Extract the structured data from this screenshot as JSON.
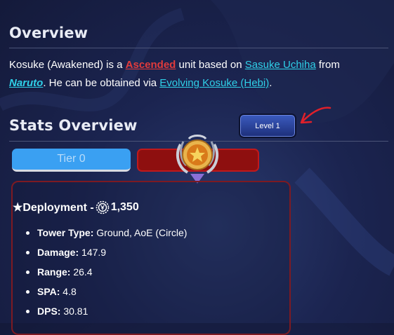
{
  "overview": {
    "heading": "Overview",
    "line1_prefix": "Kosuke (Awakened) is a ",
    "rarity_link": "Ascended",
    "line1_mid": " unit based on ",
    "character_link": "Sasuke Uchiha",
    "line1_suffix": " from",
    "series_link": "Naruto",
    "line2_mid": ". He can be obtained via ",
    "evolve_link": "Evolving Kosuke (Hebi)",
    "line2_suffix": "."
  },
  "stats_overview": {
    "heading": "Stats Overview",
    "level_button": "Level 1",
    "tabs": [
      {
        "label": "Tier 0",
        "active": true
      },
      {
        "label": "",
        "active": false
      }
    ],
    "deployment_label": "★Deployment -",
    "deployment_cost": "1,350",
    "stats": [
      {
        "label": "Tower Type:",
        "value": " Ground, AoE (Circle)"
      },
      {
        "label": "Damage:",
        "value": " 147.9"
      },
      {
        "label": "Range:",
        "value": " 26.4"
      },
      {
        "label": "SPA:",
        "value": " 4.8"
      },
      {
        "label": "DPS:",
        "value": " 30.81"
      }
    ]
  },
  "colors": {
    "ascended": "#e23b3b",
    "link": "#2fd0e8",
    "tab_active": "#3aa0f2",
    "tab_inactive": "#8e0f0f",
    "annotation_arrow": "#e0202a"
  },
  "icons": [
    "yen-coin-icon",
    "tier-emblem-icon",
    "annotation-arrow-icon"
  ]
}
